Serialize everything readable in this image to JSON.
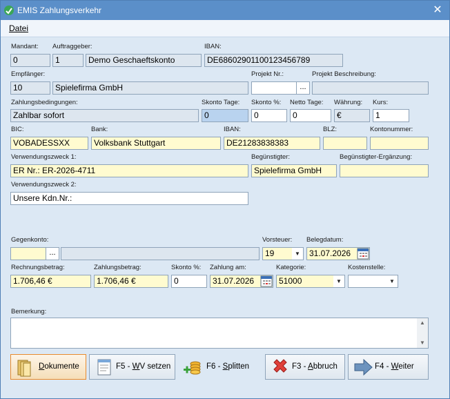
{
  "window": {
    "title": "EMIS Zahlungsverkehr",
    "close_glyph": "✕"
  },
  "menu": {
    "items": [
      "Datei"
    ]
  },
  "labels": {
    "mandant": "Mandant:",
    "auftraggeber": "Auftraggeber:",
    "iban1": "IBAN:",
    "empfaenger": "Empfänger:",
    "projekt_nr": "Projekt Nr.:",
    "projekt_beschreibung": "Projekt Beschreibung:",
    "zahlungsbedingungen": "Zahlungsbedingungen:",
    "skonto_tage": "Skonto Tage:",
    "skonto_pct": "Skonto %:",
    "netto_tage": "Netto Tage:",
    "waehrung": "Währung:",
    "kurs": "Kurs:",
    "bic": "BIC:",
    "bank": "Bank:",
    "iban2": "IBAN:",
    "blz": "BLZ:",
    "kontonummer": "Kontonummer:",
    "verwendungszweck1": "Verwendungszweck 1:",
    "beguenstigter": "Begünstigter:",
    "beguenstigter_ergaenzung": "Begünstigter-Ergänzung:",
    "verwendungszweck2": "Verwendungszweck 2:",
    "gegenkonto": "Gegenkonto:",
    "vorsteuer": "Vorsteuer:",
    "belegdatum": "Belegdatum:",
    "rechnungsbetrag": "Rechnungsbetrag:",
    "zahlungsbetrag": "Zahlungsbetrag:",
    "skonto_pct2": "Skonto %:",
    "zahlung_am": "Zahlung am:",
    "kategorie": "Kategorie:",
    "kostenstelle": "Kostenstelle:",
    "bemerkung": "Bemerkung:"
  },
  "values": {
    "mandant": "0",
    "auftraggeber_nr": "1",
    "auftraggeber_name": "Demo Geschaeftskonto",
    "iban1": "DE68602901100123456789",
    "empfaenger_nr": "10",
    "empfaenger_name": "Spielefirma GmbH",
    "projekt_nr": "",
    "projekt_beschreibung": "",
    "zahlungsbedingungen": "Zahlbar sofort",
    "skonto_tage": "0",
    "skonto_pct": "0",
    "netto_tage": "0",
    "waehrung": "€",
    "kurs": "1",
    "bic": "VOBADESSXX",
    "bank": "Volksbank Stuttgart",
    "iban2": "DE21283838383",
    "blz": "",
    "kontonummer": "",
    "verwendungszweck1": "ER Nr.: ER-2026-4711",
    "beguenstigter": "Spielefirma GmbH",
    "beguenstigter_ergaenzung": "",
    "verwendungszweck2": "Unsere Kdn.Nr.:",
    "gegenkonto_nr": "",
    "gegenkonto_name": "",
    "vorsteuer": "19",
    "belegdatum": "31.07.2026",
    "rechnungsbetrag": "1.706,46 €",
    "zahlungsbetrag": "1.706,46 €",
    "skonto_pct2": "0",
    "zahlung_am": "31.07.2026",
    "kategorie": "51000",
    "kostenstelle": "",
    "bemerkung": ""
  },
  "glyphs": {
    "dots": "...",
    "dropdown": "▼",
    "scroll_up": "▲",
    "scroll_down": "▼"
  },
  "buttons": {
    "dokumente": {
      "prefix": "",
      "key": "D",
      "rest": "okumente",
      "icon": "folder-icon"
    },
    "wv": {
      "prefix": "F5 - ",
      "key": "W",
      "rest": "V setzen",
      "icon": "calendar-note-icon"
    },
    "splitten": {
      "prefix": "F6 - ",
      "key": "S",
      "rest": "plitten",
      "icon": "coins-icon"
    },
    "abbruch": {
      "prefix": "F3 - ",
      "key": "A",
      "rest": "bbruch",
      "icon": "red-x-icon"
    },
    "weiter": {
      "prefix": "F4 - ",
      "key": "W",
      "rest": "eiter",
      "icon": "arrow-right-icon"
    }
  },
  "colors": {
    "title_bar": "#5b8fc9",
    "window_bg": "#dce8f4",
    "readonly_field": "#dde6ef",
    "highlight_field": "#fffbd0",
    "selected_field": "#b9d3ef"
  }
}
